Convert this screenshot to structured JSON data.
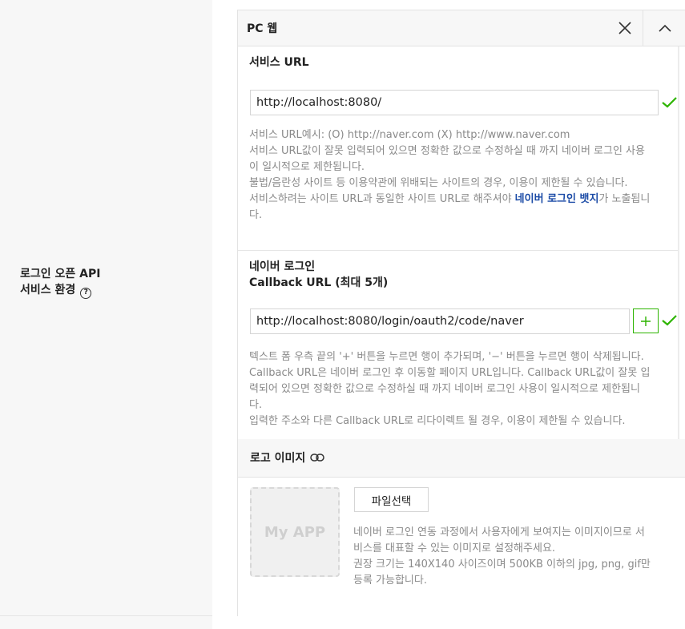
{
  "section": {
    "label_line1": "로그인 오픈 API",
    "label_line2": "서비스 환경",
    "help_icon_glyph": "?"
  },
  "panel": {
    "title": "PC 웹",
    "close_icon": "close-icon",
    "collapse_icon": "chevron-up-icon"
  },
  "service_url": {
    "title": "서비스 URL",
    "value": "http://localhost:8080/",
    "valid": true,
    "help": {
      "line1": "서비스 URL예시: (O) http://naver.com (X) http://www.naver.com",
      "line2": "서비스 URL값이 잘못 입력되어 있으면 정확한 값으로 수정하실 때 까지 네이버 로그인 사용",
      "line3": "이 일시적으로 제한됩니다.",
      "line4": "불법/음란성 사이트 등 이용약관에 위배되는 사이트의 경우, 이용이 제한될 수 있습니다.",
      "line5_before": "서비스하려는 사이트 URL과 동일한 사이트 URL로 해주셔야 ",
      "line5_link": "네이버 로그인 뱃지",
      "line5_after": "가 노출됩니",
      "line6": "다."
    }
  },
  "callback": {
    "title_line1": "네이버 로그인",
    "title_line2": "Callback URL (최대 5개)",
    "value": "http://localhost:8080/login/oauth2/code/naver",
    "add_glyph": "+",
    "valid": true,
    "help": {
      "line1": "텍스트 폼 우측 끝의 '+' 버튼을 누르면 행이 추가되며, '−' 버튼을 누르면 행이 삭제됩니다.",
      "line2": "Callback URL은 네이버 로그인 후 이동할 페이지 URL입니다. Callback URL값이 잘못 입",
      "line3": "력되어 있으면 정확한 값으로 수정하실 때 까지 네이버 로그인 사용이 일시적으로 제한됩니",
      "line4": "다.",
      "line5": "입력한 주소와 다른 Callback URL로 리다이렉트 될 경우, 이용이 제한될 수 있습니다."
    }
  },
  "logo": {
    "title": "로고 이미지",
    "link_icon": "link-icon",
    "placeholder": "My APP",
    "file_button": "파일선택",
    "help": {
      "line1": "네이버 로그인 연동 과정에서 사용자에게 보여지는 이미지이므로 서",
      "line2": "비스를 대표할 수 있는 이미지로 설정해주세요.",
      "line3": "권장 크기는 140X140 사이즈이며 500KB 이하의 jpg, png, gif만",
      "line4": "등록 가능합니다."
    }
  },
  "colors": {
    "accent_green": "#2db400",
    "link_blue": "#1a4aa6",
    "help_gray": "#8a8a8a"
  }
}
